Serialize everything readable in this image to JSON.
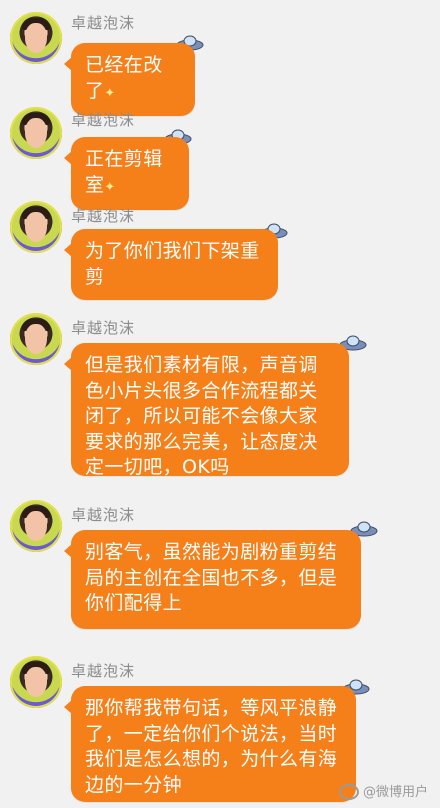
{
  "sender": "卓越泡沫",
  "messages": [
    {
      "text": "已经在改了"
    },
    {
      "text": "正在剪辑室"
    },
    {
      "text": "为了你们我们下架重剪"
    },
    {
      "text": "但是我们素材有限，声音调色小片头很多合作流程都关闭了，所以可能不会像大家要求的那么完美，让态度决定一切吧，OK吗"
    },
    {
      "text": "别客气，虽然能为剧粉重剪结局的主创在全国也不多，但是你们配得上"
    },
    {
      "text": "那你帮我带句话，等风平浪静了，一定给你们个说法，当时我们是怎么想的，为什么有海边的一分钟"
    }
  ],
  "watermark": "@微博用户"
}
